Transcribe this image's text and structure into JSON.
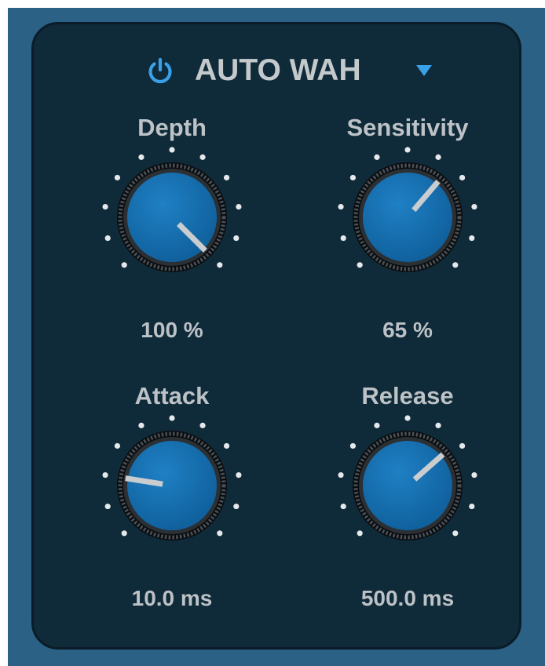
{
  "plugin": {
    "title": "AUTO WAH",
    "power_on": true,
    "accent_color": "#3aa0e8"
  },
  "knobs": [
    {
      "id": "depth",
      "label": "Depth",
      "value_text": "100 %",
      "level": 1.0
    },
    {
      "id": "sensitivity",
      "label": "Sensitivity",
      "value_text": "65 %",
      "level": 0.65
    },
    {
      "id": "attack",
      "label": "Attack",
      "value_text": "10.0 ms",
      "level": 0.2
    },
    {
      "id": "release",
      "label": "Release",
      "value_text": "500.0 ms",
      "level": 0.68
    }
  ],
  "icons": {
    "power": "power-icon",
    "dropdown": "triangle-down-icon"
  }
}
